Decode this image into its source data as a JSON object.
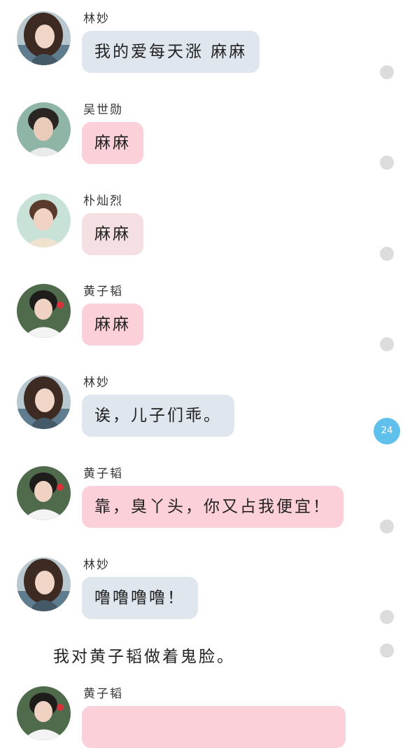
{
  "messages": [
    {
      "sender": "林妙",
      "text": "我的爱每天涨  麻麻",
      "avatar": "girl-avatar-icon"
    },
    {
      "sender": "吴世勋",
      "text": "麻麻",
      "avatar": "boy-avatar-icon"
    },
    {
      "sender": "朴灿烈",
      "text": "麻麻",
      "avatar": "boy-avatar-icon"
    },
    {
      "sender": "黄子韬",
      "text": "麻麻",
      "avatar": "boy-avatar-icon"
    },
    {
      "sender": "林妙",
      "text": "诶，儿子们乖。",
      "avatar": "girl-avatar-icon"
    },
    {
      "sender": "黄子韬",
      "text": "靠，臭丫头，你又占我便宜！",
      "avatar": "boy-avatar-icon"
    },
    {
      "sender": "林妙",
      "text": "噜噜噜噜！",
      "avatar": "girl-avatar-icon"
    },
    {
      "sender": "黄子韬",
      "text": "",
      "avatar": "boy-avatar-icon"
    }
  ],
  "narration": "我对黄子韬做着鬼脸。",
  "comment_count": "24",
  "colors": {
    "bubble_gray": "#dfe6ee",
    "bubble_pink": "#fcd0d9",
    "bubble_pale": "#f4dfe2",
    "comment_badge": "#5fc0ec",
    "dot": "#dcdcdc"
  }
}
